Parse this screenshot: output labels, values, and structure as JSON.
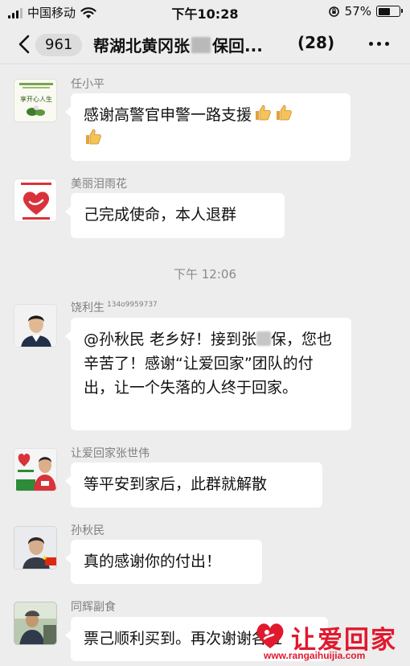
{
  "status_bar": {
    "carrier": "中国移动",
    "time": "下午10:28",
    "battery": "57%",
    "battery_level": 0.57
  },
  "nav": {
    "unread_count": "961",
    "title_part1": "帮湖北黄冈张",
    "title_part2": "保回...",
    "member_count": "(28)"
  },
  "messages": [
    {
      "sender": "任小平",
      "text": "感谢高警官申警一路支援",
      "avatar_text": "享开心人生"
    },
    {
      "sender": "美丽泪雨花",
      "text": "己完成使命，本人退群"
    },
    {
      "sender": "饶利生",
      "sender_extra": "134o9959737",
      "text_part1": "@孙秋民 老乡好！接到张",
      "text_part2": "保，您也辛苦了！感谢“让爱回家”团队的付出，让一个失落的人终于回家。"
    },
    {
      "sender": "让爱回家张世伟",
      "text": "等平安到家后，此群就解散"
    },
    {
      "sender": "孙秋民",
      "text": "真的感谢你的付出！"
    },
    {
      "sender": "同辉副食",
      "text": "票己顺利买到。再次谢谢各位"
    }
  ],
  "timestamp": "下午 12:06",
  "watermark": {
    "brand": "让爱回家",
    "url": "www.rangaihuijia.com"
  },
  "colors": {
    "background": "#ededed",
    "bubble": "#ffffff",
    "watermark_red": "#e0192e"
  }
}
